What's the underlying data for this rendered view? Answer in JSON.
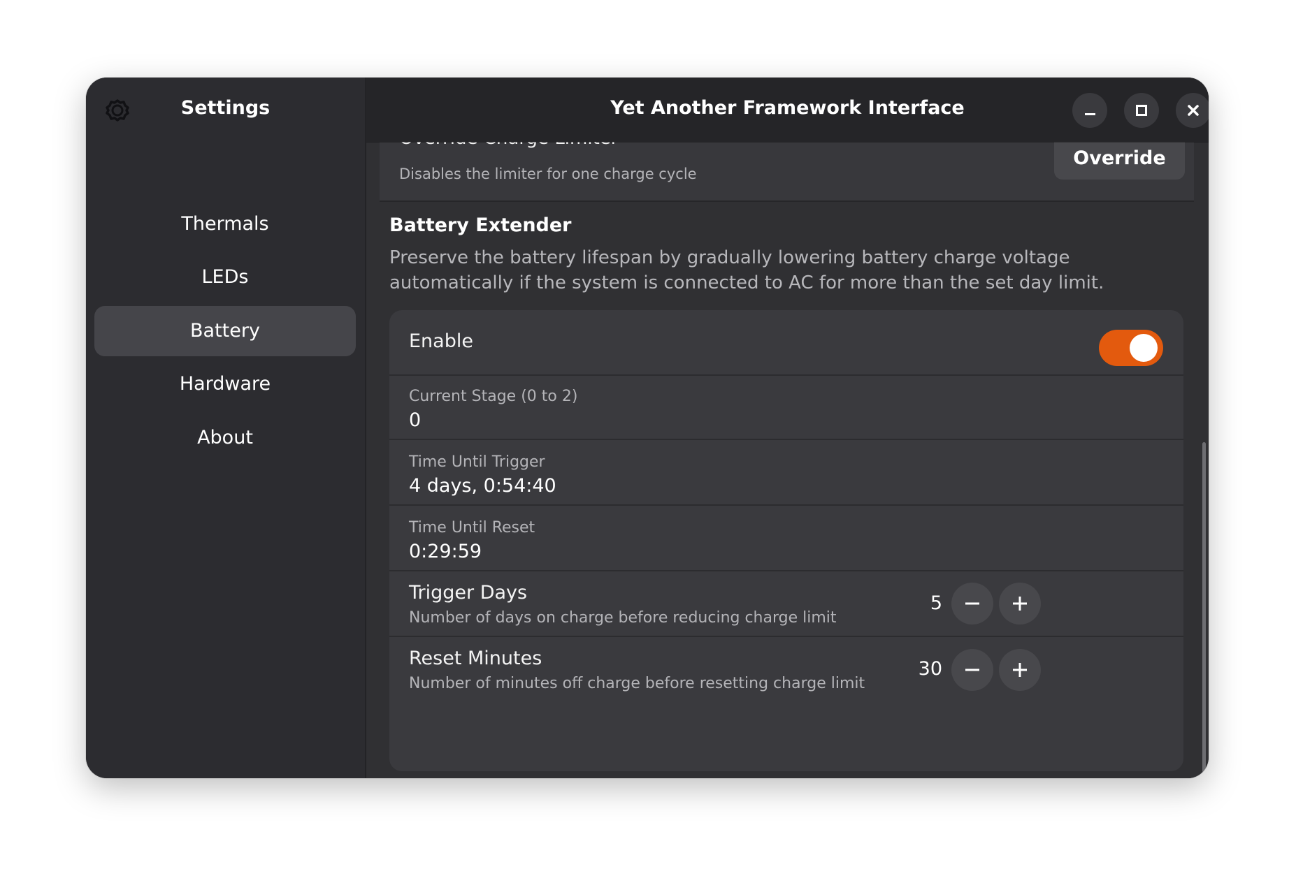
{
  "sidebar": {
    "title": "Settings",
    "items": [
      {
        "label": "Thermals"
      },
      {
        "label": "LEDs"
      },
      {
        "label": "Battery"
      },
      {
        "label": "Hardware"
      },
      {
        "label": "About"
      }
    ],
    "active": "Battery",
    "icon": "gear-icon"
  },
  "header": {
    "title": "Yet Another Framework Interface",
    "buttons": [
      "minimize-icon",
      "maximize-icon",
      "close-icon"
    ]
  },
  "charge_limiter": {
    "title": "Override Charge Limiter",
    "subtitle": "Disables the limiter for one charge cycle",
    "button_label": "Override"
  },
  "battery_extender": {
    "title": "Battery Extender",
    "description": "Preserve the battery lifespan by gradually lowering battery charge voltage automatically if the system is connected to AC for more than the set day limit.",
    "enable": {
      "label": "Enable",
      "on": true
    },
    "current_stage": {
      "label": "Current Stage (0 to 2)",
      "value": "0"
    },
    "time_until_trigger": {
      "label": "Time Until Trigger",
      "value": "4 days, 0:54:40"
    },
    "time_until_reset": {
      "label": "Time Until Reset",
      "value": "0:29:59"
    },
    "trigger_days": {
      "label": "Trigger Days",
      "subtitle": "Number of days on charge before reducing charge limit",
      "value": "5"
    },
    "reset_minutes": {
      "label": "Reset Minutes",
      "subtitle": "Number of minutes off charge before resetting charge limit",
      "value": "30"
    }
  },
  "colors": {
    "accent": "#e35a0e",
    "background": "#303033",
    "sidebar": "#2c2c30",
    "headerbar": "#252528"
  }
}
